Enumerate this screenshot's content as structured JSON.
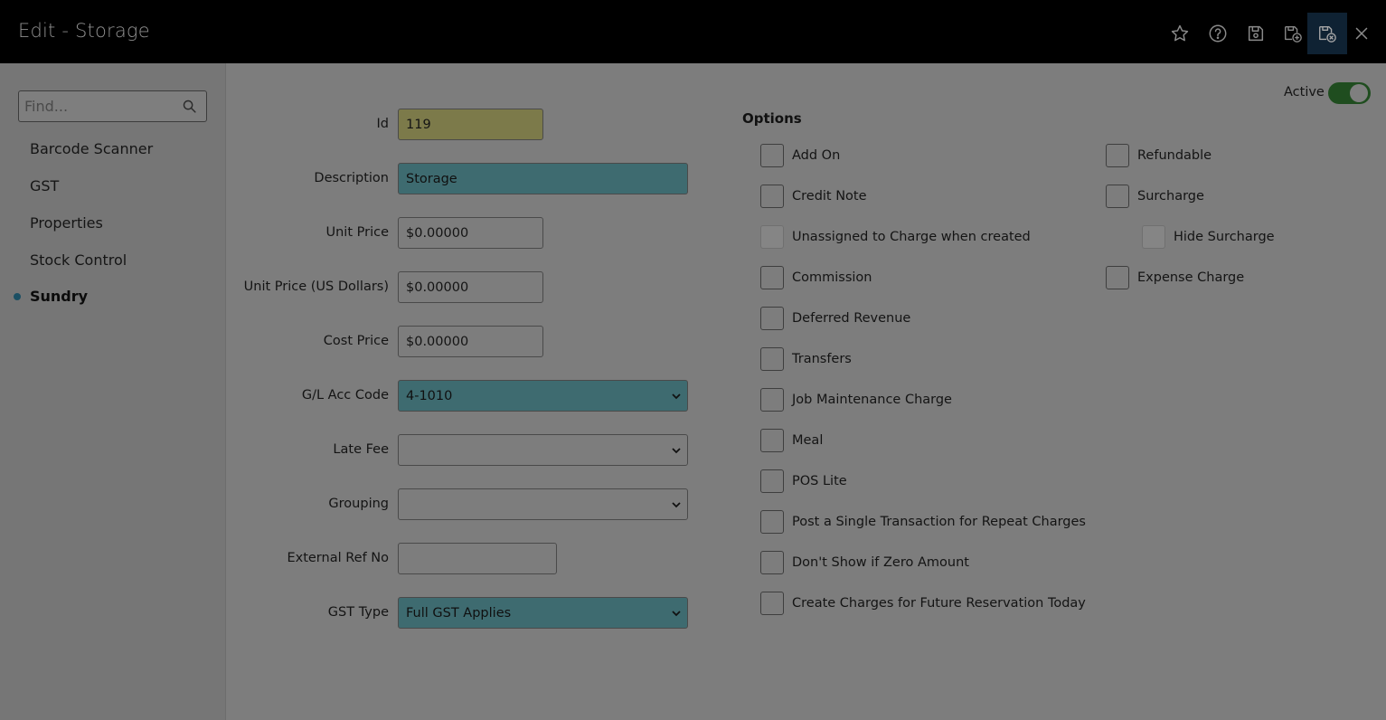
{
  "header": {
    "title": "Edit - Storage",
    "icons": [
      "star-icon",
      "help-icon",
      "save-icon",
      "save-new-icon",
      "save-close-icon",
      "close-icon"
    ]
  },
  "sidebar": {
    "search_placeholder": "Find...",
    "items": [
      {
        "label": "Barcode Scanner"
      },
      {
        "label": "GST"
      },
      {
        "label": "Properties"
      },
      {
        "label": "Stock Control"
      },
      {
        "label": "Sundry",
        "active": true
      }
    ]
  },
  "form": {
    "id_label": "Id",
    "id_value": "119",
    "description_label": "Description",
    "description_value": "Storage",
    "unit_price_label": "Unit Price",
    "unit_price_value": "$0.00000",
    "unit_price_usd_label": "Unit Price (US Dollars)",
    "unit_price_usd_value": "$0.00000",
    "cost_price_label": "Cost Price",
    "cost_price_value": "$0.00000",
    "gl_acc_label": "G/L Acc Code",
    "gl_acc_value": "4-1010",
    "late_fee_label": "Late Fee",
    "late_fee_value": "",
    "grouping_label": "Grouping",
    "grouping_value": "",
    "external_ref_label": "External Ref No",
    "external_ref_value": "",
    "gst_type_label": "GST Type",
    "gst_type_value": "Full GST Applies"
  },
  "active": {
    "label": "Active",
    "on": true
  },
  "options": {
    "title": "Options",
    "left": [
      {
        "label": "Add On",
        "checked": false
      },
      {
        "label": "Credit Note",
        "checked": false
      },
      {
        "label": "Unassigned to Charge when created",
        "checked": false,
        "disabled": true
      },
      {
        "label": "Commission",
        "checked": false
      },
      {
        "label": "Deferred Revenue",
        "checked": false
      },
      {
        "label": "Transfers",
        "checked": false
      },
      {
        "label": "Job Maintenance Charge",
        "checked": false
      },
      {
        "label": "Meal",
        "checked": false
      },
      {
        "label": "POS Lite",
        "checked": false
      },
      {
        "label": "Post a Single Transaction for Repeat Charges",
        "checked": false
      },
      {
        "label": "Don't Show if Zero Amount",
        "checked": false
      },
      {
        "label": "Create Charges for Future Reservation Today",
        "checked": false
      }
    ],
    "right": [
      {
        "label": "Refundable",
        "checked": false
      },
      {
        "label": "Surcharge",
        "checked": false
      },
      {
        "label": "Hide Surcharge",
        "checked": false,
        "disabled": true
      },
      {
        "label": "Expense Charge",
        "checked": false
      }
    ]
  },
  "colors": {
    "header_bg": "#000000",
    "overlay_gray": "#7d7d7d",
    "teal_field": "#3e6b70",
    "yellow_field": "#7c7a4a",
    "toggle_on": "#1f4d1f",
    "active_icon_bg": "#0f2233"
  }
}
